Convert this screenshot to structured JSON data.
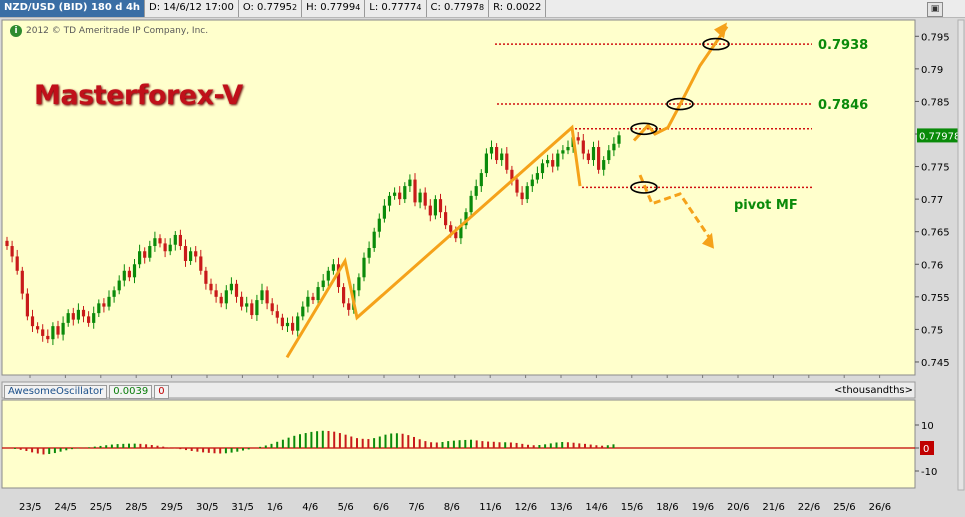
{
  "infobar": {
    "symbol": "NZD/USD (BID) 180 d 4h",
    "date": "D: 14/6/12 17:00",
    "open": "O: 0.7795",
    "open_sub": "2",
    "high": "H: 0.7799",
    "high_sub": "4",
    "low": "L: 0.7777",
    "low_sub": "4",
    "close": "C: 0.7797",
    "close_sub": "8",
    "range": "R: 0.0022"
  },
  "copyright": "2012 © TD Ameritrade IP Company, Inc.",
  "logo_text": "Masterforex-V",
  "oscillator": {
    "name": "AwesomeOscillator",
    "value": "0.0039",
    "zero": "0",
    "units": "<thousandths>"
  },
  "annotations": {
    "level1": "0.7938",
    "level2": "0.7846",
    "pivot": "pivot MF",
    "last_price": "0.77978"
  },
  "colors": {
    "panel_bg": "#ffffcc",
    "up_candle": "#0a8a0a",
    "down_candle": "#c81a1a",
    "annot": "#f5a21a",
    "level_line": "#d01010",
    "label_green": "#0a8a0a"
  },
  "chart_data": {
    "type": "candlestick",
    "y_ticks": [
      "0.795",
      "0.79",
      "0.785",
      "0.78",
      "0.775",
      "0.77",
      "0.765",
      "0.76",
      "0.755",
      "0.75",
      "0.745"
    ],
    "ylim": [
      0.743,
      0.7975
    ],
    "x_ticks": [
      "23/5",
      "24/5",
      "25/5",
      "28/5",
      "29/5",
      "30/5",
      "31/5",
      "1/6",
      "4/6",
      "5/6",
      "6/6",
      "7/6",
      "8/6",
      "11/6",
      "12/6",
      "13/6",
      "14/6",
      "15/6",
      "18/6",
      "19/6",
      "20/6",
      "21/6",
      "22/6",
      "25/6",
      "26/6"
    ],
    "close": [
      0.7628,
      0.7612,
      0.759,
      0.7555,
      0.752,
      0.7505,
      0.75,
      0.749,
      0.7485,
      0.7505,
      0.7492,
      0.751,
      0.7525,
      0.7515,
      0.753,
      0.752,
      0.751,
      0.7525,
      0.754,
      0.7535,
      0.755,
      0.756,
      0.7575,
      0.759,
      0.758,
      0.76,
      0.762,
      0.761,
      0.7628,
      0.764,
      0.7632,
      0.762,
      0.763,
      0.7645,
      0.7628,
      0.7605,
      0.762,
      0.7612,
      0.759,
      0.757,
      0.756,
      0.755,
      0.754,
      0.756,
      0.757,
      0.755,
      0.7535,
      0.754,
      0.7522,
      0.7545,
      0.756,
      0.754,
      0.7528,
      0.7518,
      0.7505,
      0.751,
      0.7498,
      0.752,
      0.7535,
      0.755,
      0.7545,
      0.7565,
      0.7575,
      0.759,
      0.76,
      0.7565,
      0.754,
      0.753,
      0.756,
      0.758,
      0.761,
      0.7625,
      0.765,
      0.767,
      0.769,
      0.7705,
      0.771,
      0.77,
      0.772,
      0.773,
      0.7695,
      0.771,
      0.769,
      0.7675,
      0.77,
      0.768,
      0.766,
      0.765,
      0.764,
      0.766,
      0.768,
      0.7705,
      0.772,
      0.774,
      0.777,
      0.778,
      0.776,
      0.777,
      0.7745,
      0.773,
      0.771,
      0.77,
      0.772,
      0.773,
      0.774,
      0.7755,
      0.776,
      0.775,
      0.777,
      0.7775,
      0.778,
      0.7795,
      0.779,
      0.777,
      0.776,
      0.778,
      0.7745,
      0.776,
      0.7775,
      0.7785,
      0.7798
    ]
  },
  "ao_data": [
    -0.4,
    -0.8,
    -1.3,
    -1.9,
    -2.4,
    -2.8,
    -2.6,
    -2.2,
    -1.6,
    -1.0,
    -0.5,
    -0.2,
    0.1,
    0.3,
    0.6,
    0.9,
    1.2,
    1.5,
    1.7,
    1.8,
    1.9,
    1.9,
    1.8,
    1.6,
    1.3,
    1.0,
    0.6,
    0.2,
    -0.2,
    -0.5,
    -0.9,
    -1.3,
    -1.6,
    -1.9,
    -2.1,
    -2.3,
    -2.4,
    -2.3,
    -2.0,
    -1.6,
    -1.1,
    -0.6,
    0.0,
    0.5,
    1.1,
    1.8,
    2.7,
    3.6,
    4.5,
    5.3,
    6.0,
    6.5,
    7.0,
    7.3,
    7.5,
    7.4,
    7.1,
    6.5,
    5.8,
    5.0,
    4.3,
    4.0,
    3.9,
    4.3,
    5.0,
    5.8,
    6.3,
    6.4,
    6.2,
    5.6,
    4.8,
    3.8,
    3.0,
    2.5,
    2.4,
    2.6,
    3.0,
    3.2,
    3.4,
    3.5,
    3.6,
    3.3,
    3.0,
    2.8,
    2.7,
    2.5,
    2.5,
    2.4,
    2.2,
    1.8,
    1.4,
    1.2,
    1.3,
    1.6,
    2.0,
    2.4,
    2.6,
    2.5,
    2.3,
    2.0,
    1.8,
    1.5,
    1.2,
    1.0,
    1.2,
    1.6
  ],
  "ao_ticks": [
    "10",
    "0",
    "-10"
  ]
}
